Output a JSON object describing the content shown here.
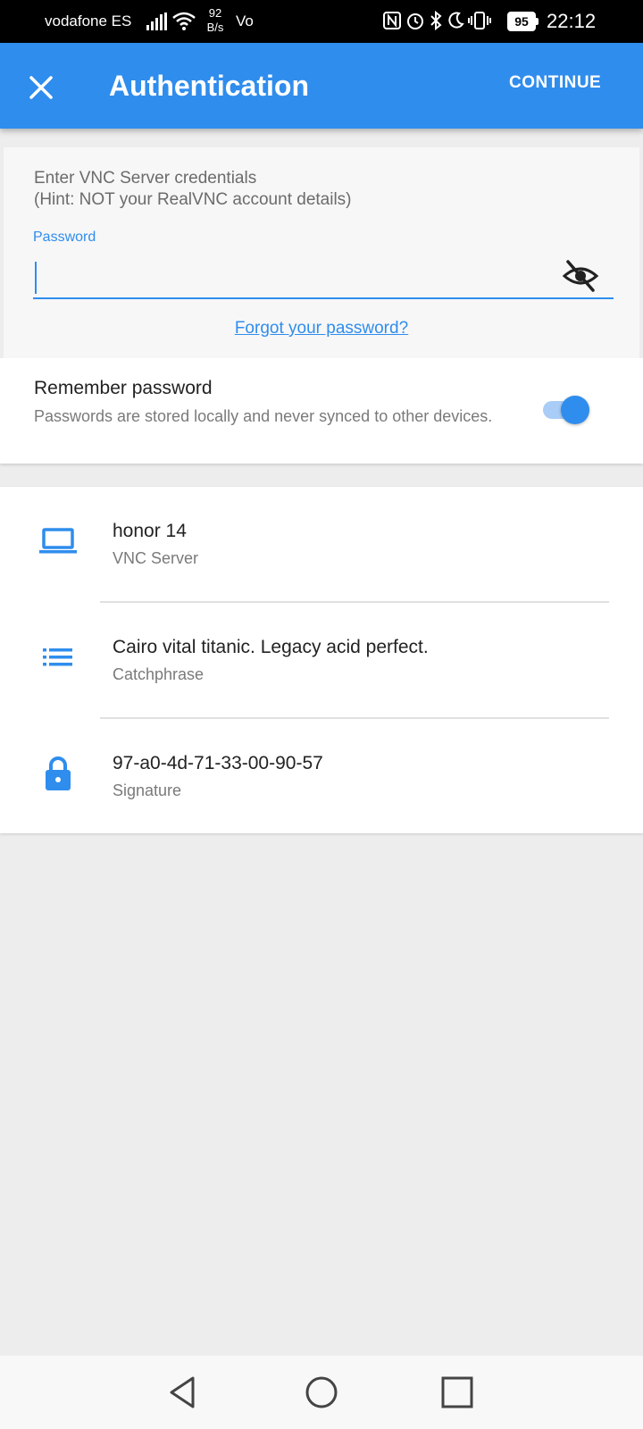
{
  "status_bar": {
    "carrier": "vodafone ES",
    "speed_value": "92",
    "speed_unit": "B/s",
    "volte": "Vo",
    "battery": "95",
    "time": "22:12"
  },
  "app_bar": {
    "title": "Authentication",
    "continue_label": "CONTINUE"
  },
  "credentials": {
    "hint": "Enter VNC Server credentials\n(Hint: NOT your RealVNC account details)",
    "password_label": "Password",
    "password_value": "",
    "forgot_link": "Forgot your password?"
  },
  "remember": {
    "title": "Remember password",
    "description": "Passwords are stored locally and never synced to other devices.",
    "enabled": true
  },
  "info": {
    "server": {
      "name": "honor 14",
      "type": "VNC Server",
      "icon": "laptop-icon"
    },
    "catchphrase": {
      "value": "Cairo vital titanic. Legacy acid perfect.",
      "label": "Catchphrase",
      "icon": "list-icon"
    },
    "signature": {
      "value": "97-a0-4d-71-33-00-90-57",
      "label": "Signature",
      "icon": "lock-icon"
    }
  },
  "colors": {
    "accent": "#2f8ded",
    "background": "#ededed"
  }
}
